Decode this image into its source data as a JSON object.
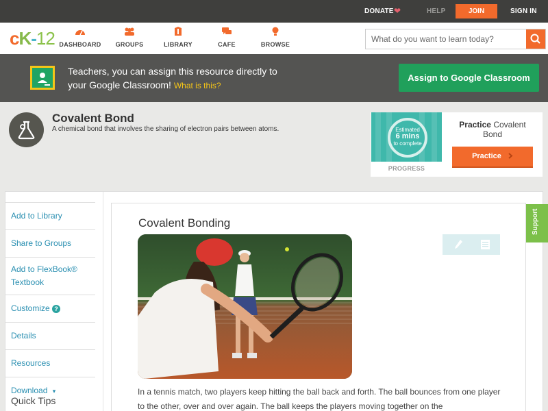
{
  "topbar": {
    "donate": "DONATE",
    "help": "HELP",
    "join": "JOIN",
    "signin": "SIGN IN"
  },
  "nav": {
    "logo": {
      "c": "c",
      "k": "K",
      "dash": "-",
      "num": "12"
    },
    "items": [
      {
        "label": "DASHBOARD",
        "icon": "dashboard-icon"
      },
      {
        "label": "GROUPS",
        "icon": "groups-icon"
      },
      {
        "label": "LIBRARY",
        "icon": "library-icon"
      },
      {
        "label": "CAFE",
        "icon": "cafe-icon"
      },
      {
        "label": "BROWSE",
        "icon": "browse-icon"
      }
    ],
    "search_placeholder": "What do you want to learn today?"
  },
  "banner": {
    "line1": "Teachers, you can assign this resource directly to",
    "line2": "your Google Classroom!",
    "what_link": "What is this?",
    "button": "Assign to Google Classroom"
  },
  "concept": {
    "title": "Covalent Bond",
    "description": "A chemical bond that involves the sharing of electron pairs between atoms."
  },
  "practice": {
    "estimated": "Estimated",
    "mins": "6 mins",
    "to_complete": "to complete",
    "progress_label": "PROGRESS",
    "title_bold": "Practice",
    "title_rest": "Covalent Bond",
    "button": "Practice"
  },
  "sidebar": {
    "items": [
      "Add to Library",
      "Share to Groups",
      "Add to FlexBook® Textbook",
      "Customize",
      "Details",
      "Resources",
      "Download"
    ],
    "customize_badge": "?",
    "download_caret": "▾",
    "quick_tips": "Quick Tips"
  },
  "content": {
    "title": "Covalent Bonding",
    "paragraph": "In a tennis match, two players keep hitting the ball back and forth. The ball bounces from one player to the other, over and over again. The ball keeps the players moving together on the"
  },
  "support": {
    "label": "Support"
  },
  "colors": {
    "accent": "#f26a2c",
    "topbar": "#3f3f3d",
    "banner": "#545452",
    "google_green": "#20a05b",
    "link": "#2a8fb1",
    "support": "#7cc04a"
  }
}
